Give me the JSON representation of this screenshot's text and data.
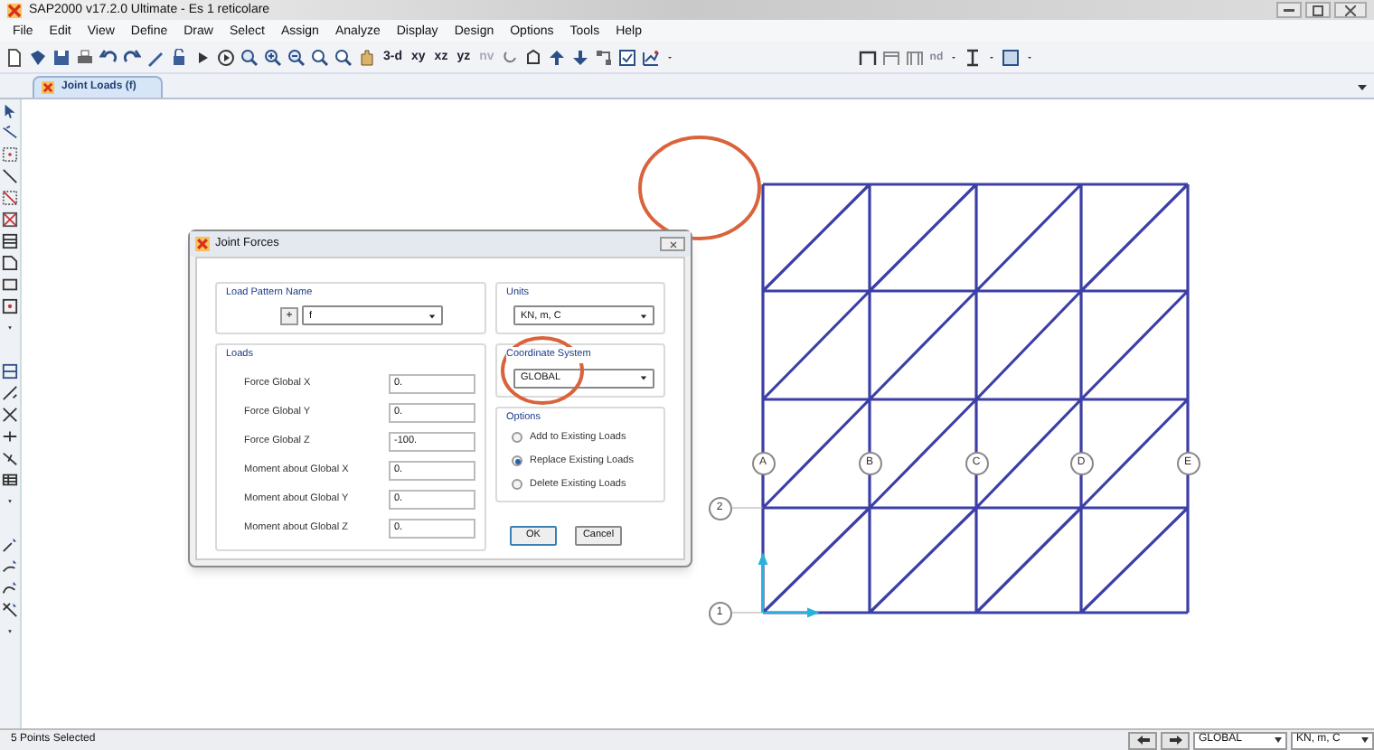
{
  "window": {
    "title": "SAP2000 v17.2.0 Ultimate  - Es 1 reticolare"
  },
  "menu": [
    "File",
    "Edit",
    "View",
    "Define",
    "Draw",
    "Select",
    "Assign",
    "Analyze",
    "Display",
    "Design",
    "Options",
    "Tools",
    "Help"
  ],
  "toolbar": {
    "view_buttons": [
      "3-d",
      "xy",
      "xz",
      "yz",
      "nv"
    ],
    "section_label": "nd"
  },
  "document_tab": {
    "label": "Joint Loads (f)",
    "selected": true
  },
  "dialog": {
    "title": "Joint Forces",
    "load_pattern": {
      "label": "Load Pattern Name",
      "add": "+",
      "value": "f"
    },
    "units": {
      "label": "Units",
      "value": "KN, m, C"
    },
    "coordinate_system": {
      "label": "Coordinate System",
      "value": "GLOBAL"
    },
    "loads": {
      "label": "Loads",
      "rows": [
        {
          "label": "Force Global X",
          "value": "0."
        },
        {
          "label": "Force Global Y",
          "value": "0."
        },
        {
          "label": "Force Global Z",
          "value": "-100."
        },
        {
          "label": "Moment about Global X",
          "value": "0."
        },
        {
          "label": "Moment about Global Y",
          "value": "0."
        },
        {
          "label": "Moment about Global Z",
          "value": "0."
        }
      ]
    },
    "options": {
      "label": "Options",
      "items": [
        {
          "label": "Add to Existing Loads",
          "selected": false
        },
        {
          "label": "Replace Existing Loads",
          "selected": true
        },
        {
          "label": "Delete Existing Loads",
          "selected": false
        }
      ]
    },
    "buttons": [
      "OK",
      "Cancel"
    ]
  },
  "grid": {
    "x_bubbles": [
      "A",
      "B",
      "C",
      "D",
      "E"
    ],
    "y_bubbles": [
      "2",
      "1"
    ]
  },
  "status_bar": {
    "text": "5 Points Selected",
    "coordinate_system": "GLOBAL",
    "units": "KN, m, C"
  }
}
